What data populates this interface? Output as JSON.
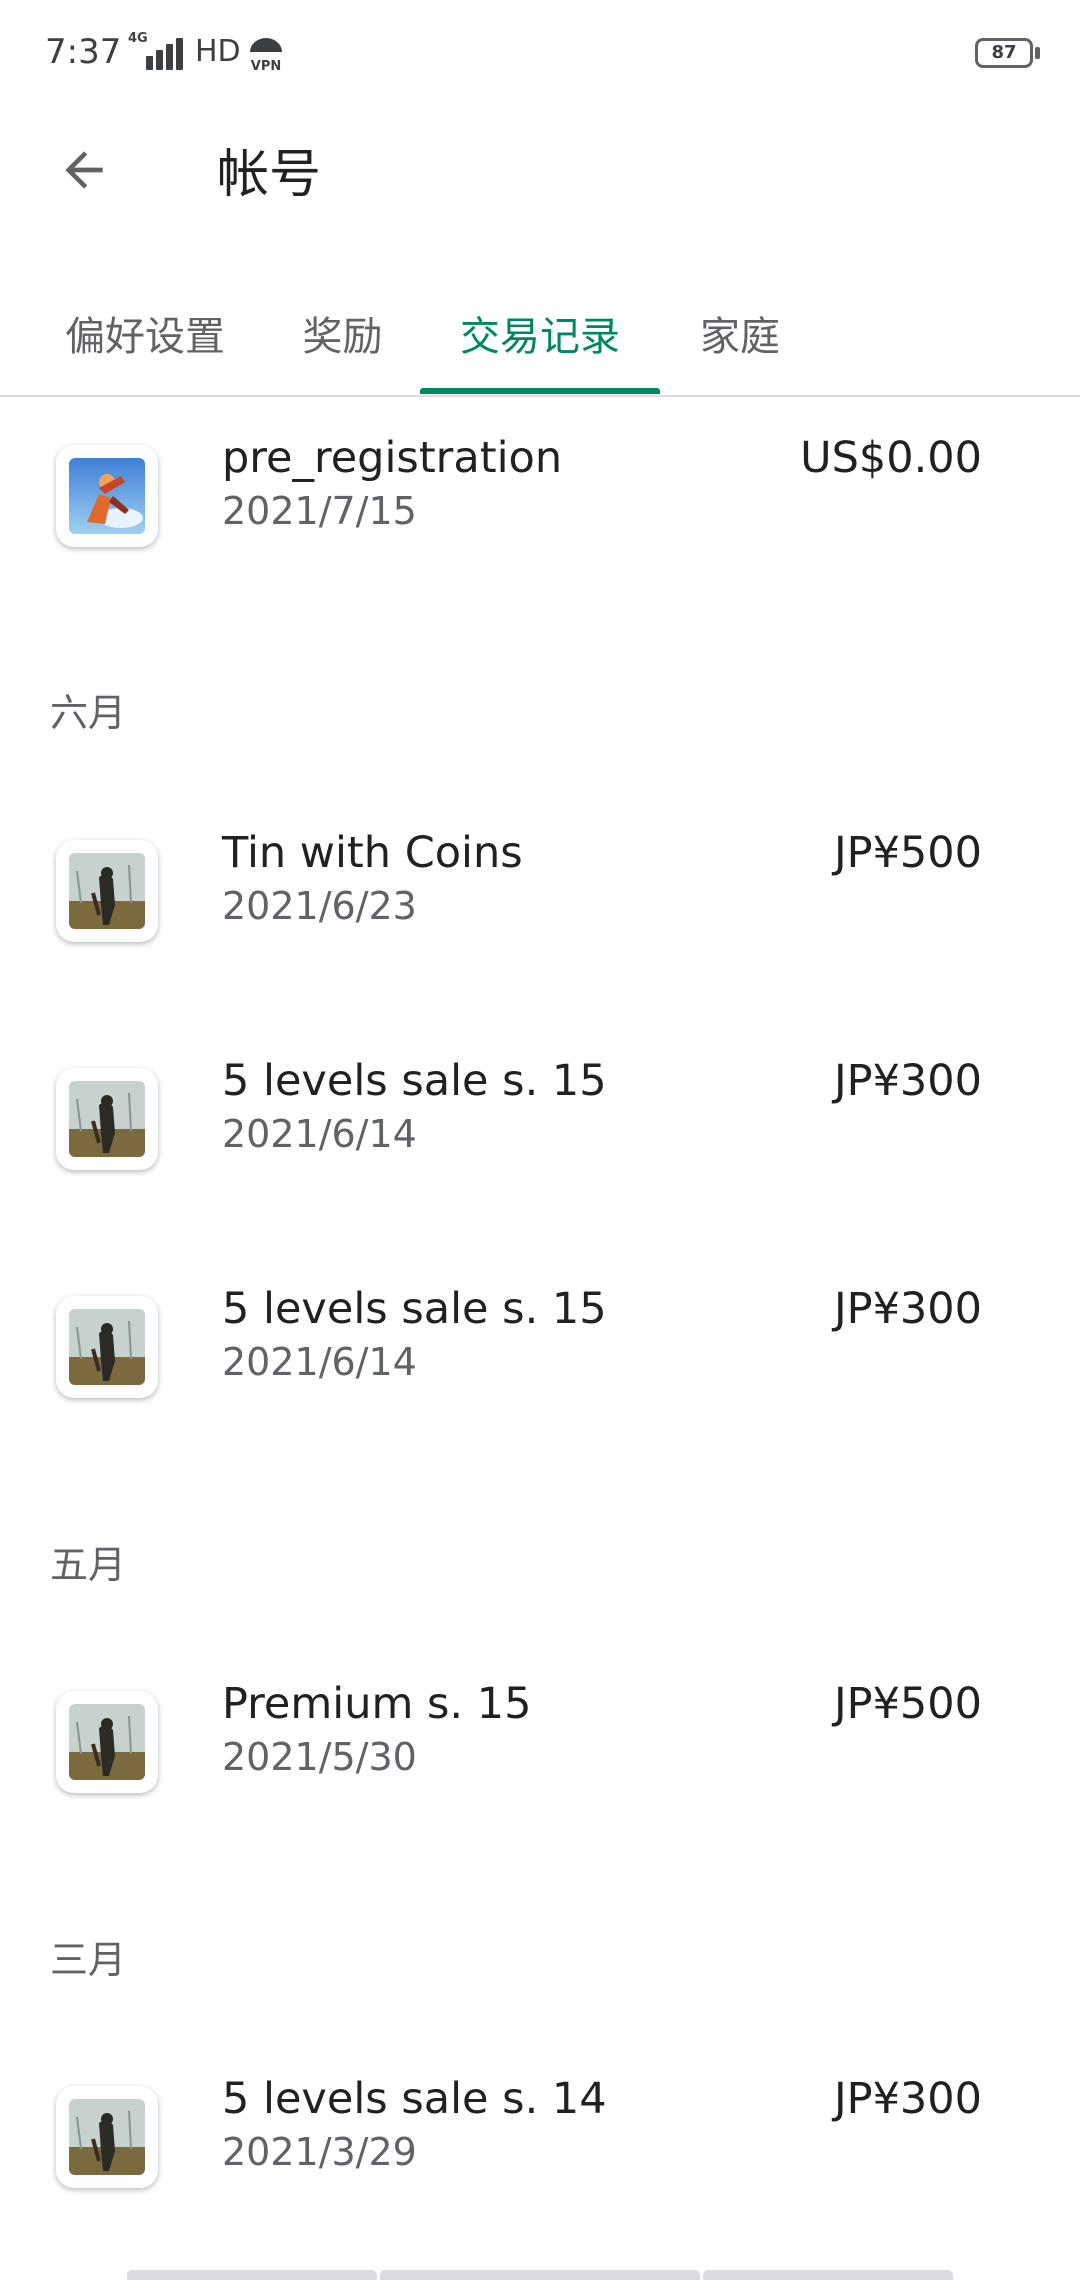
{
  "status_bar": {
    "time": "7:37",
    "network": "4G",
    "hd": "HD",
    "vpn": "VPN",
    "battery": "87"
  },
  "app_bar": {
    "title": "帐号",
    "back_icon": "arrow-back-icon"
  },
  "tabs": [
    {
      "label": "偏好设置",
      "active": false
    },
    {
      "label": "奖励",
      "active": false
    },
    {
      "label": "交易记录",
      "active": true
    },
    {
      "label": "家庭",
      "active": false
    }
  ],
  "accent_color": "#01875f",
  "transactions": {
    "first": {
      "title": "pre_registration",
      "date": "2021/7/15",
      "amount": "US$0.00",
      "icon": "hero-game-icon"
    },
    "june_header": "六月",
    "june": [
      {
        "title": "Tin with Coins",
        "date": "2021/6/23",
        "amount": "JP¥500",
        "icon": "survivor-game-icon"
      },
      {
        "title": "5 levels sale s. 15",
        "date": "2021/6/14",
        "amount": "JP¥300",
        "icon": "survivor-game-icon"
      },
      {
        "title": "5 levels sale s. 15",
        "date": "2021/6/14",
        "amount": "JP¥300",
        "icon": "survivor-game-icon"
      }
    ],
    "may_header": "五月",
    "may": [
      {
        "title": "Premium s. 15",
        "date": "2021/5/30",
        "amount": "JP¥500",
        "icon": "survivor-game-icon"
      }
    ],
    "march_header": "三月",
    "march": [
      {
        "title": "5 levels sale s. 14",
        "date": "2021/3/29",
        "amount": "JP¥300",
        "icon": "survivor-game-icon"
      }
    ]
  }
}
